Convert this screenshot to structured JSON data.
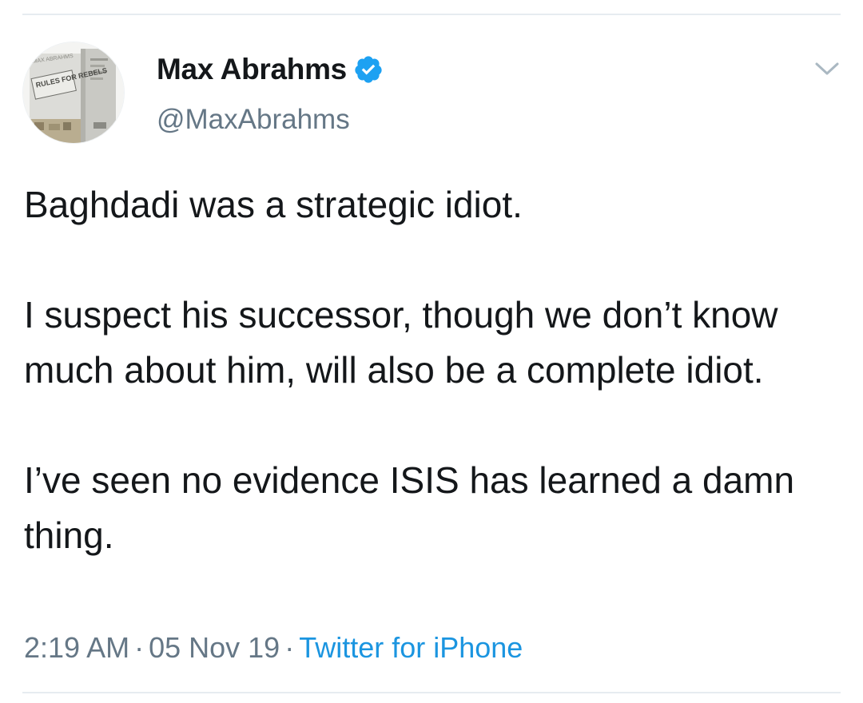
{
  "tweet": {
    "author": {
      "display_name": "Max Abrahms",
      "handle": "@MaxAbrahms",
      "verified": true,
      "avatar_icon": "book-cover-avatar",
      "avatar_text": "RULES FOR REBELS"
    },
    "text": "Baghdadi was a strategic idiot.\n\nI suspect his successor, though we don’t know much about him, will also be a complete idiot.\n\nI’ve seen no evidence ISIS has learned a damn thing.",
    "time": "2:19 AM",
    "date": "05 Nov 19",
    "separator": "·",
    "source": "Twitter for iPhone",
    "menu_icon": "chevron-down-icon"
  },
  "colors": {
    "text_primary": "#14171a",
    "text_secondary": "#657786",
    "link": "#1b95e0",
    "verified_badge": "#1da1f2",
    "divider": "#e6ecf0"
  }
}
